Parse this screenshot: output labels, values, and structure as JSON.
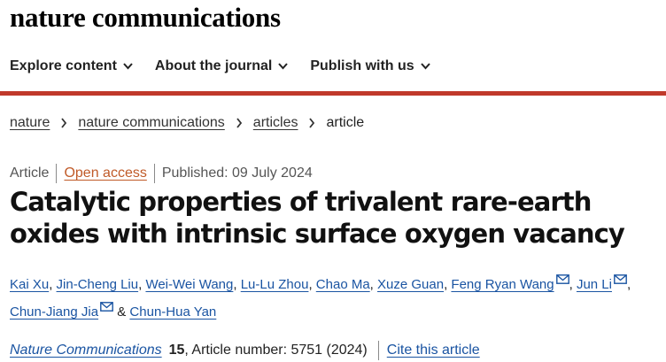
{
  "brand": {
    "name": "nature communications"
  },
  "nav": {
    "items": [
      {
        "label": "Explore content"
      },
      {
        "label": "About the journal"
      },
      {
        "label": "Publish with us"
      }
    ]
  },
  "breadcrumb": {
    "items": [
      "nature",
      "nature communications",
      "articles"
    ],
    "current": "article"
  },
  "meta": {
    "type": "Article",
    "access": "Open access",
    "published": "Published: 09 July 2024"
  },
  "article": {
    "title": "Catalytic properties of trivalent rare-earth oxides with intrinsic surface oxygen vacancy"
  },
  "authors": [
    "Kai Xu",
    "Jin-Cheng Liu",
    "Wei-Wei Wang",
    "Lu-Lu Zhou",
    "Chao Ma",
    "Xuze Guan",
    "Feng Ryan Wang",
    "Jun Li",
    "Chun-Jiang Jia",
    "Chun-Hua Yan"
  ],
  "authors_misc": {
    "ampersand": "&"
  },
  "citation": {
    "journal": "Nature Communications",
    "volume": "15",
    "article_number": ", Article number: 5751 (2024)",
    "cite_label": "Cite this article"
  },
  "colors": {
    "accent_red": "#c0392b",
    "link_blue": "#1a54a2",
    "open_access": "#c05a28"
  }
}
